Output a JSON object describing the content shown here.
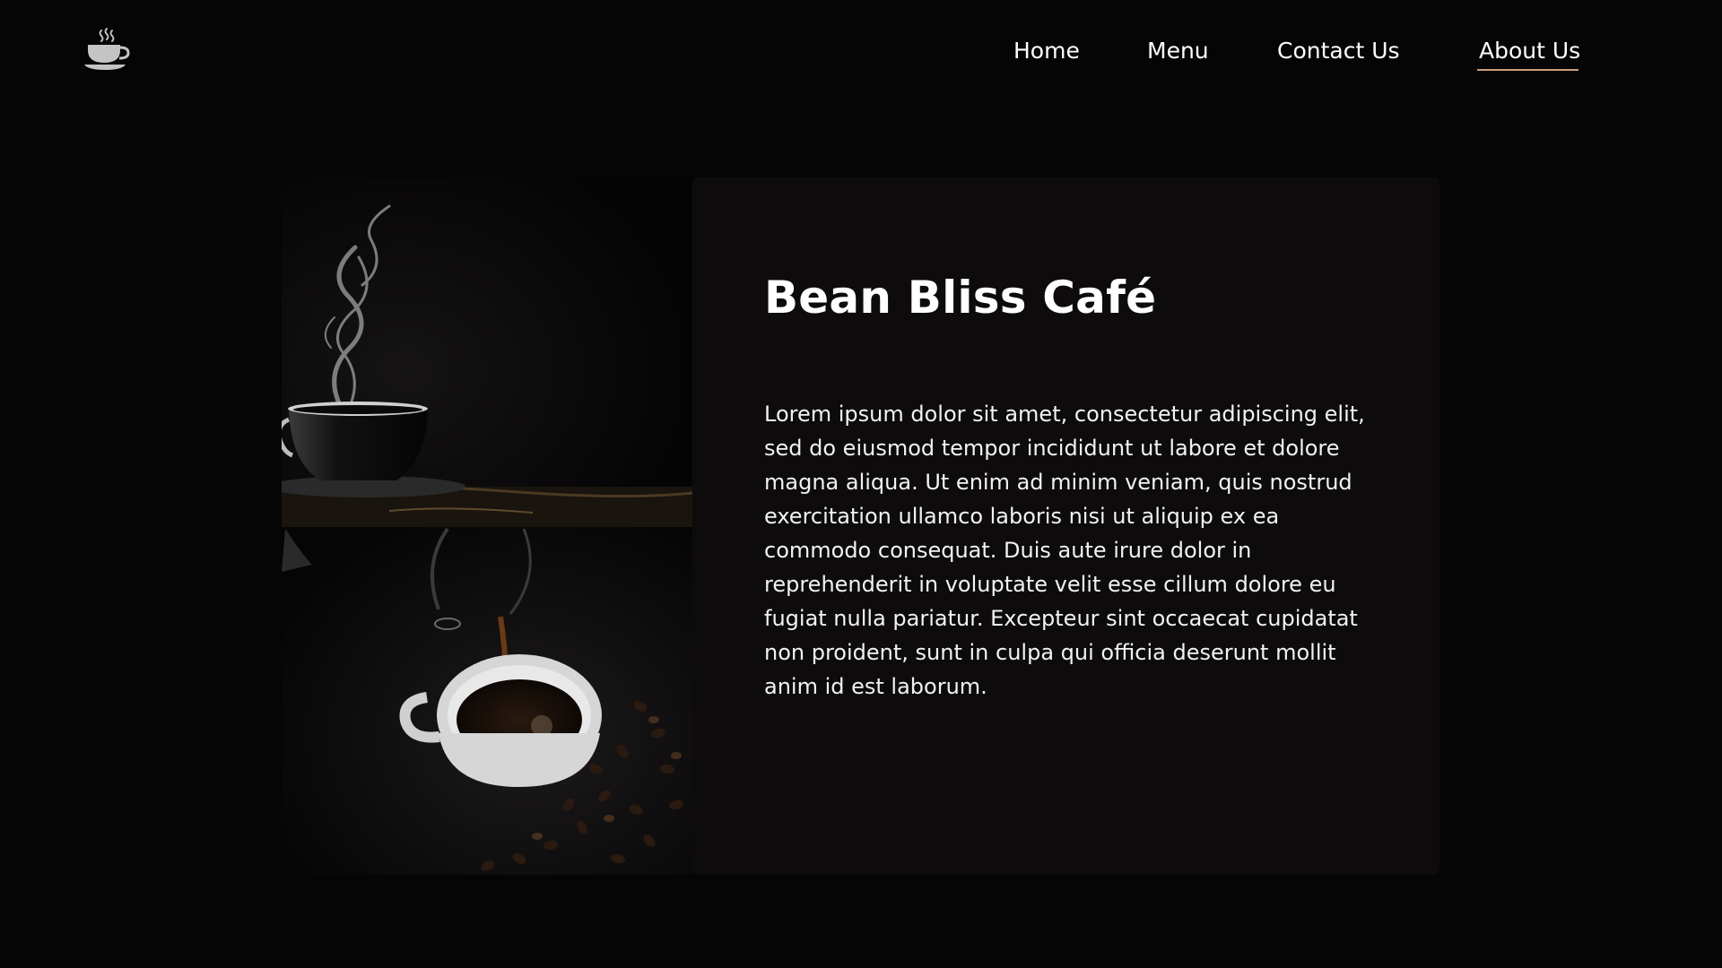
{
  "header": {
    "logo_icon": "coffee-cup-steam-icon",
    "nav": [
      {
        "label": "Home",
        "active": false
      },
      {
        "label": "Menu",
        "active": false
      },
      {
        "label": "Contact Us",
        "active": false
      },
      {
        "label": "About Us",
        "active": true
      }
    ]
  },
  "about": {
    "title": "Bean Bliss Café",
    "description": "Lorem ipsum dolor sit amet, consectetur adipiscing elit, sed do eiusmod tempor incididunt ut labore et dolore magna aliqua. Ut enim ad minim veniam, quis nostrud exercitation ullamco laboris nisi ut aliquip ex ea commodo consequat. Duis aute irure dolor in reprehenderit in voluptate velit esse cillum dolore eu fugiat nulla pariatur. Excepteur sint occaecat cupidatat non proident, sunt in culpa qui officia deserunt mollit anim id est laborum.",
    "photo_icon": "coffee-photo-collage"
  },
  "colors": {
    "background": "#060506",
    "card": "#0e0b0c",
    "accent_underline": "#c9a07a",
    "text": "#ffffff"
  }
}
